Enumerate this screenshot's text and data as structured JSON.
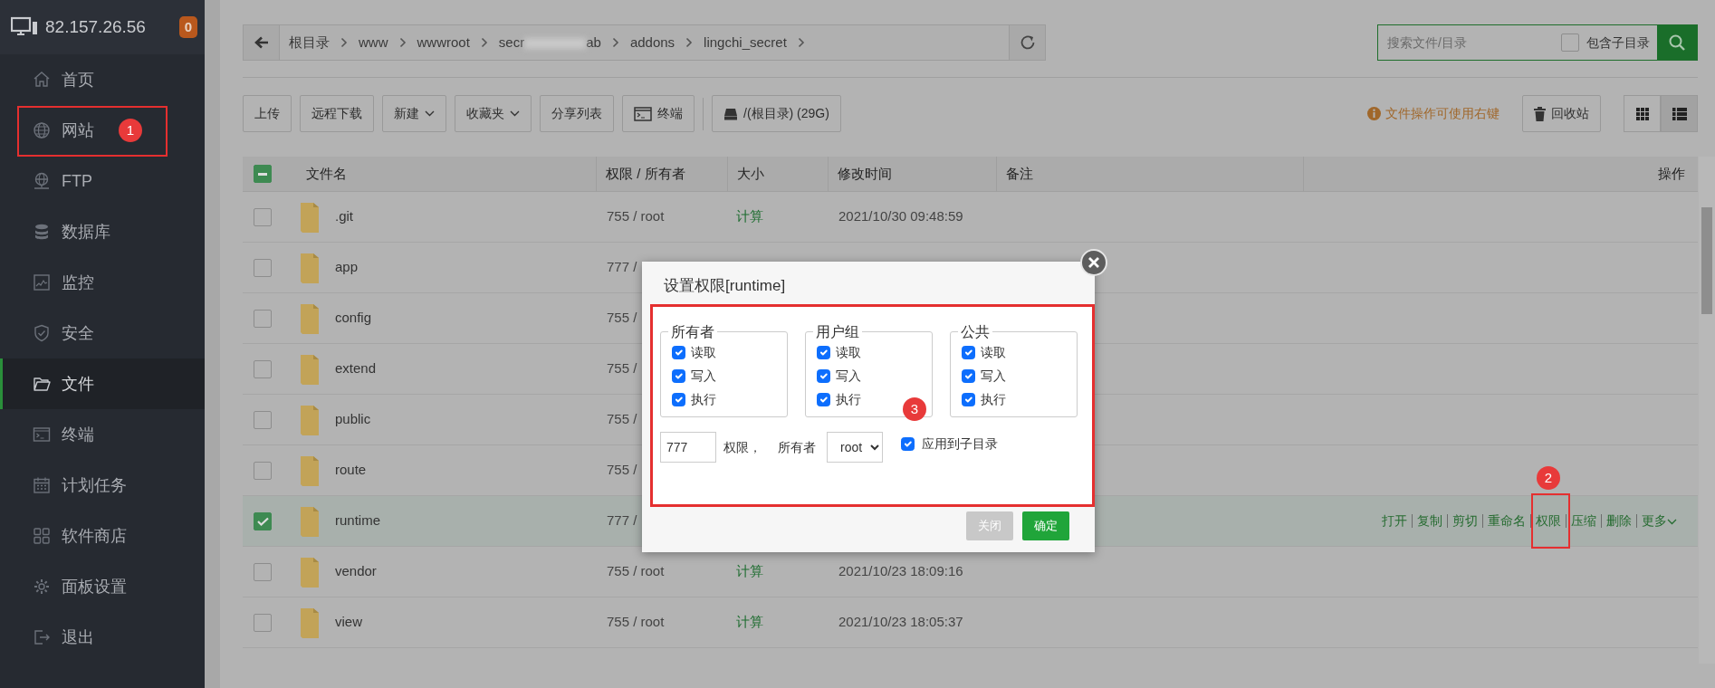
{
  "sidebar": {
    "host": "82.157.26.56",
    "alert_count": "0",
    "items": [
      {
        "label": "首页",
        "selected": false
      },
      {
        "label": "网站",
        "selected": false,
        "highlighted": true,
        "marker": "1"
      },
      {
        "label": "FTP",
        "selected": false
      },
      {
        "label": "数据库",
        "selected": false
      },
      {
        "label": "监控",
        "selected": false
      },
      {
        "label": "安全",
        "selected": false
      },
      {
        "label": "文件",
        "selected": true
      },
      {
        "label": "终端",
        "selected": false
      },
      {
        "label": "计划任务",
        "selected": false
      },
      {
        "label": "软件商店",
        "selected": false
      },
      {
        "label": "面板设置",
        "selected": false
      },
      {
        "label": "退出",
        "selected": false
      }
    ]
  },
  "breadcrumb": {
    "crumbs": [
      {
        "label": "根目录"
      },
      {
        "label": "www"
      },
      {
        "label": "wwwroot"
      },
      {
        "label": "secr",
        "label_end": "ab",
        "redacted": true
      },
      {
        "label": "addons"
      },
      {
        "label": "lingchi_secret"
      }
    ]
  },
  "search": {
    "placeholder": "搜索文件/目录",
    "include_subdirs": {
      "label": "包含子目录",
      "checked": false
    }
  },
  "toolbar": {
    "buttons": [
      {
        "label": "上传",
        "kind": "plain"
      },
      {
        "label": "远程下载",
        "kind": "plain"
      },
      {
        "label": "新建",
        "kind": "dropdown"
      },
      {
        "label": "收藏夹",
        "kind": "dropdown"
      },
      {
        "label": "分享列表",
        "kind": "plain"
      },
      {
        "label": "终端",
        "kind": "terminal"
      },
      {
        "label": "/(根目录) (29G)",
        "kind": "disk"
      }
    ],
    "hint": "文件操作可使用右键",
    "recycle": "回收站",
    "views": [
      {
        "kind": "grid",
        "selected": false
      },
      {
        "kind": "list",
        "selected": true
      }
    ]
  },
  "table": {
    "columns": [
      "文件名",
      "权限 / 所有者",
      "大小",
      "修改时间",
      "备注",
      "操作"
    ],
    "select_all_indeterminate": true,
    "rows": [
      {
        "name": ".git",
        "perm": "755 / root",
        "size": "计算",
        "modified": "2021/10/30 09:48:59",
        "selected": false
      },
      {
        "name": "app",
        "perm": "777 /",
        "selected": false
      },
      {
        "name": "config",
        "perm": "755 /",
        "selected": false
      },
      {
        "name": "extend",
        "perm": "755 /",
        "selected": false
      },
      {
        "name": "public",
        "perm": "755 /",
        "selected": false
      },
      {
        "name": "route",
        "perm": "755 /",
        "selected": false
      },
      {
        "name": "runtime",
        "perm": "777 /",
        "selected": true,
        "actions": [
          {
            "label": "打开"
          },
          {
            "label": "复制"
          },
          {
            "label": "剪切"
          },
          {
            "label": "重命名"
          },
          {
            "label": "权限",
            "highlighted": true,
            "marker": "2"
          },
          {
            "label": "压缩"
          },
          {
            "label": "删除"
          },
          {
            "label": "更多",
            "kind": "dropdown"
          }
        ]
      },
      {
        "name": "vendor",
        "perm": "755 / root",
        "size": "计算",
        "modified": "2021/10/23 18:09:16",
        "selected": false
      },
      {
        "name": "view",
        "perm": "755 / root",
        "size": "计算",
        "modified": "2021/10/23 18:05:37",
        "selected": false
      }
    ]
  },
  "modal": {
    "title": "设置权限[runtime]",
    "highlighted": true,
    "marker": "3",
    "groups": [
      {
        "legend": "所有者",
        "items": [
          {
            "label": "读取",
            "checked": true
          },
          {
            "label": "写入",
            "checked": true
          },
          {
            "label": "执行",
            "checked": true
          }
        ]
      },
      {
        "legend": "用户组",
        "items": [
          {
            "label": "读取",
            "checked": true
          },
          {
            "label": "写入",
            "checked": true
          },
          {
            "label": "执行",
            "checked": true
          }
        ]
      },
      {
        "legend": "公共",
        "items": [
          {
            "label": "读取",
            "checked": true
          },
          {
            "label": "写入",
            "checked": true
          },
          {
            "label": "执行",
            "checked": true
          }
        ]
      }
    ],
    "mode": "777",
    "mode_label": "权限，",
    "owner_label": "所有者",
    "owner": "root",
    "apply_subdirs": {
      "label": "应用到子目录",
      "checked": true
    },
    "buttons": [
      {
        "label": "关闭",
        "kind": "secondary"
      },
      {
        "label": "确定",
        "kind": "primary"
      }
    ]
  }
}
